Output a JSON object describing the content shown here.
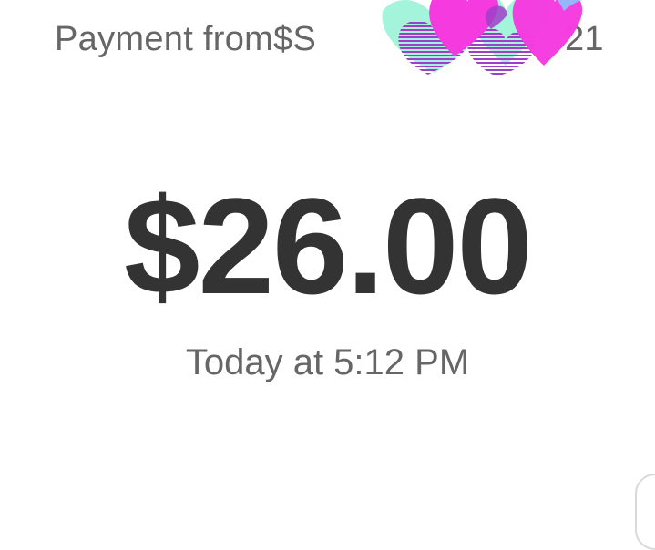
{
  "payment": {
    "header_prefix": "Payment from ",
    "cashtag_visible_start": "$S",
    "cashtag_visible_end": "21",
    "amount": "$26.00",
    "timestamp": "Today at 5:12 PM"
  },
  "sticker": {
    "icon": "hearts-sticker-icon",
    "colors": {
      "pink": "#f53bdf",
      "purple": "#9f3fc9",
      "mint": "#9ff3d9",
      "blue": "#7fd5ff"
    }
  },
  "colors": {
    "background": "#ffffff",
    "amount_text": "#333333",
    "secondary_text": "#666666"
  }
}
